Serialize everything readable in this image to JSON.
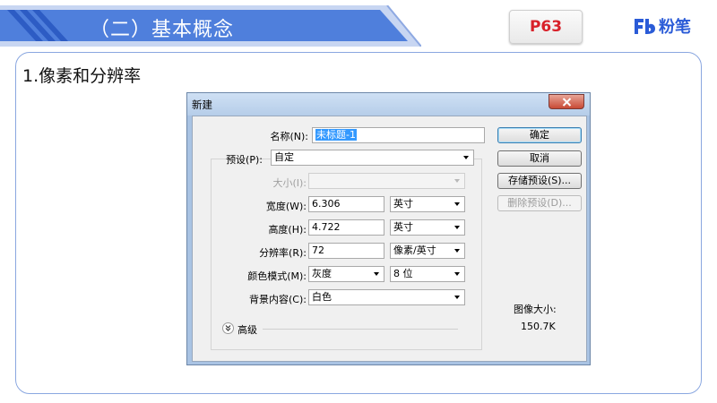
{
  "slide": {
    "title": "（二）基本概念",
    "page_badge": "P63",
    "logo_text": "粉笔",
    "section_heading": "1.像素和分辨率"
  },
  "colors": {
    "header_blue": "#4f7fdc",
    "frame_border": "#8aa7e0",
    "badge_red": "#d8212a",
    "logo_blue": "#2a5bd7"
  },
  "dialog": {
    "title": "新建",
    "name": {
      "label": "名称(N):",
      "value": "未标题-1"
    },
    "preset": {
      "label": "预设(P):",
      "value": "自定"
    },
    "size": {
      "label": "大小(I):",
      "value": ""
    },
    "width": {
      "label": "宽度(W):",
      "value": "6.306",
      "unit": "英寸"
    },
    "height": {
      "label": "高度(H):",
      "value": "4.722",
      "unit": "英寸"
    },
    "resolution": {
      "label": "分辨率(R):",
      "value": "72",
      "unit": "像素/英寸"
    },
    "color_mode": {
      "label": "颜色模式(M):",
      "value": "灰度",
      "depth": "8 位"
    },
    "background": {
      "label": "背景内容(C):",
      "value": "白色"
    },
    "advanced_label": "高级",
    "buttons": {
      "ok": "确定",
      "cancel": "取消",
      "save_preset": "存储预设(S)...",
      "delete_preset": "删除预设(D)..."
    },
    "image_size_label": "图像大小:",
    "image_size_value": "150.7K"
  }
}
